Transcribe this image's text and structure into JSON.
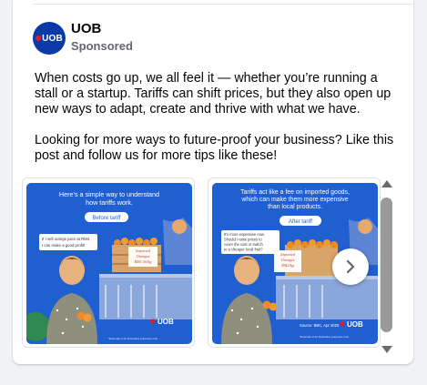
{
  "post": {
    "author": "UOB",
    "sponsored_label": "Sponsored",
    "avatar_logo_text": "UOB",
    "paragraph1": "When costs go up, we all feel it — whether you’re running a stall or a startup. Tariffs can shift prices, but they also open up new ways to adapt, create and thrive with what we have.",
    "paragraph2": "Looking for more ways to future-proof your business? Like this post and follow us for more tips like these!"
  },
  "carousel": {
    "slides": [
      {
        "headline_line1": "Here’s a simple way to understand",
        "headline_line2": "how tariffs work.",
        "pill": "Before tariff",
        "speech_line1": "If I sell orange juice at RM4,",
        "speech_line2": "I can make a good profit!",
        "sign_line1": "Imported",
        "sign_line2": "Oranges",
        "sign_line3": "RM1.50/kg",
        "brand": "UOB",
        "footnote": "*Example is for illustrative purposes only."
      },
      {
        "headline_line1": "Tariffs act like a fee on imported goods,",
        "headline_line2": "which can make them more expensive",
        "headline_line3": "than local products.",
        "pill": "After tariff",
        "speech_line1": "It’s more expensive now.",
        "speech_line2": "Should I raise prices to",
        "speech_line3": "cover the cost or switch",
        "speech_line4": "to a cheaper local fruit?",
        "sign_line1": "Imported",
        "sign_line2": "Oranges",
        "sign_line3": "RM2/kg",
        "source": "Source: BBC, Apr 2025",
        "brand": "UOB",
        "footnote": "*Example is for illustrative purposes only."
      }
    ]
  },
  "colors": {
    "uob_blue": "#0b3aa8",
    "slide_blue": "#1f5fd0",
    "uob_red": "#e11b22",
    "text_primary": "#050505",
    "text_secondary": "#65676b"
  },
  "icons": {
    "next": "chevron-right-icon",
    "scroll_up": "triangle-up-icon",
    "scroll_down": "triangle-down-icon"
  }
}
